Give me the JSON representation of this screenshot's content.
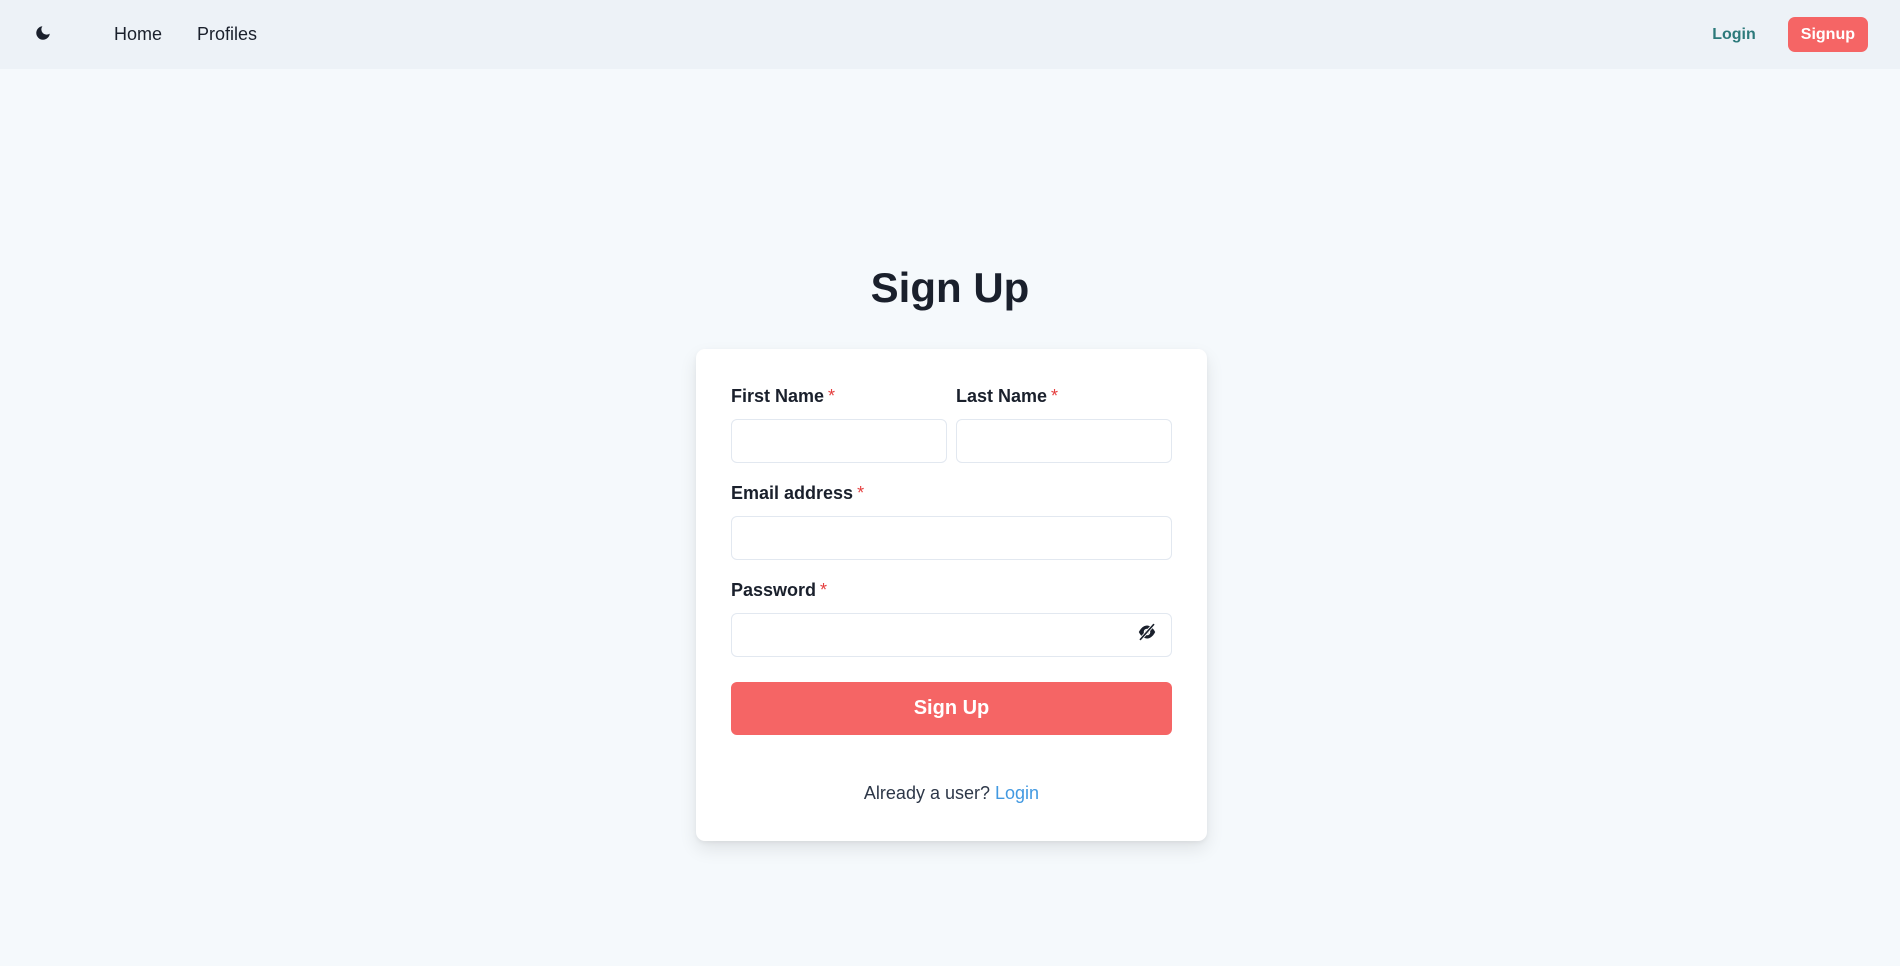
{
  "navbar": {
    "theme_icon": "moon-icon",
    "links": [
      {
        "label": "Home"
      },
      {
        "label": "Profiles"
      }
    ],
    "login_label": "Login",
    "signup_label": "Signup"
  },
  "page": {
    "title": "Sign Up"
  },
  "form": {
    "first_name": {
      "label": "First Name",
      "required_mark": "*",
      "value": ""
    },
    "last_name": {
      "label": "Last Name",
      "required_mark": "*",
      "value": ""
    },
    "email": {
      "label": "Email address",
      "required_mark": "*",
      "value": ""
    },
    "password": {
      "label": "Password",
      "required_mark": "*",
      "value": "",
      "toggle_icon": "eye-slash-icon"
    },
    "submit_label": "Sign Up",
    "footer_prompt": "Already a user?",
    "footer_link": "Login"
  },
  "colors": {
    "accent": "#f56565",
    "login_link": "#2c7a7b",
    "footer_link": "#4299e1",
    "required": "#e53e3e"
  }
}
